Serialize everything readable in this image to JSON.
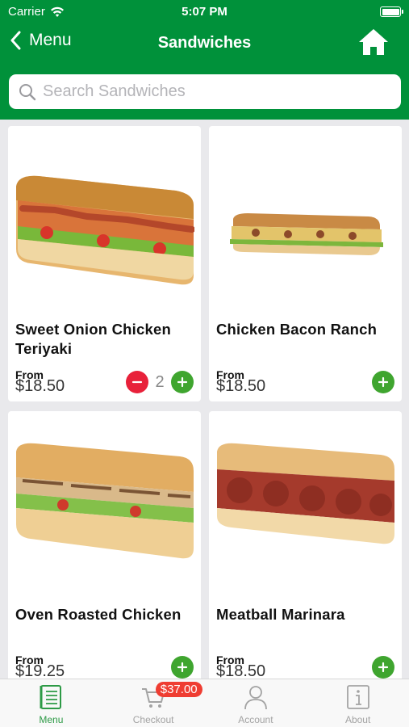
{
  "status_bar": {
    "carrier": "Carrier",
    "time": "5:07 PM"
  },
  "nav": {
    "back_label": "Menu",
    "title": "Sandwiches"
  },
  "search": {
    "placeholder": "Search Sandwiches",
    "value": ""
  },
  "colors": {
    "brand": "#00913a",
    "plus": "#3fa52f",
    "minus": "#e8213a",
    "badge": "#ef3d32"
  },
  "products": [
    {
      "name": "Sweet Onion Chicken Teriyaki",
      "from_label": "From",
      "price": "$18.50",
      "quantity": "2",
      "icon": "sandwich-teriyaki"
    },
    {
      "name": "Chicken Bacon Ranch",
      "from_label": "From",
      "price": "$18.50",
      "icon": "sandwich-bacon-ranch"
    },
    {
      "name": "Oven Roasted Chicken",
      "from_label": "From",
      "price": "$19.25",
      "icon": "sandwich-roasted-chicken"
    },
    {
      "name": "Meatball Marinara",
      "from_label": "From",
      "price": "$18.50",
      "icon": "sandwich-meatball"
    }
  ],
  "tabs": [
    {
      "label": "Menu",
      "icon": "menu-book-icon",
      "active": true
    },
    {
      "label": "Checkout",
      "icon": "cart-icon",
      "badge": "$37.00"
    },
    {
      "label": "Account",
      "icon": "person-icon"
    },
    {
      "label": "About",
      "icon": "info-icon"
    }
  ]
}
